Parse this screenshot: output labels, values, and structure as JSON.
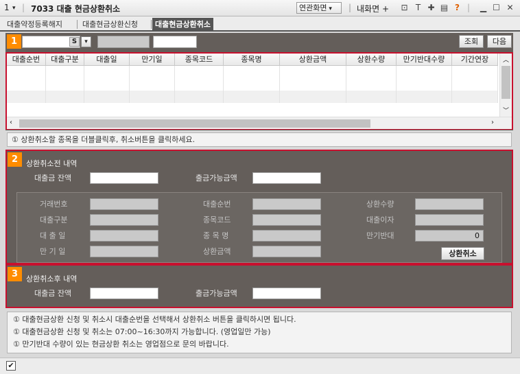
{
  "window": {
    "number_menu": "1",
    "title": "7033 대출 현금상환취소",
    "related_button": "연관화면",
    "my_screen": "내화면",
    "help_icon": "?"
  },
  "tabs": [
    {
      "label": "대출약정등록해지",
      "active": false
    },
    {
      "label": "대출현금상환신청",
      "active": false
    },
    {
      "label": "대출현금상환취소",
      "active": true
    }
  ],
  "toolbar": {
    "section_number": "1",
    "account_suffix": "S",
    "search_button": "조회",
    "next_button": "다음"
  },
  "grid": {
    "columns": [
      "대출순번",
      "대출구분",
      "대출일",
      "만기일",
      "종목코드",
      "종목명",
      "상환금액",
      "상환수량",
      "만기반대수량",
      "기간연장"
    ],
    "rows": []
  },
  "info1": "① 상환취소할 종목을 더블클릭후, 취소버튼을 클릭하세요.",
  "section2": {
    "number": "2",
    "title": "상환취소전 내역",
    "loan_balance_label": "대출금 잔액",
    "withdrawable_label": "출금가능금액",
    "fields": {
      "trade_no": "거래번호",
      "loan_seq": "대출순번",
      "repay_qty": "상환수량",
      "loan_type": "대출구분",
      "stock_code": "종목코드",
      "loan_interest": "대출이자",
      "loan_date": "대 출 일",
      "stock_name": "종 목 명",
      "maturity_opposite": "만기반대",
      "maturity_opposite_value": "0",
      "maturity_date": "만 기 일",
      "repay_amount": "상환금액"
    },
    "cancel_button": "상환취소"
  },
  "section3": {
    "number": "3",
    "title": "상환취소후 내역",
    "loan_balance_label": "대출금 잔액",
    "withdrawable_label": "출금가능금액"
  },
  "notices": [
    "① 대출현금상환 신청 및 취소시 대출순번을 선택해서 상환취소 버튼을 클릭하시면 됩니다.",
    "① 대출현금상환 신청 및 취소는 07:00~16:30까지 가능합니다. (영업일만 가능)",
    "① 만기반대 수량이 있는 현금상환 취소는 영업점으로 문의 바랍니다."
  ],
  "status_checkbox": "✔"
}
